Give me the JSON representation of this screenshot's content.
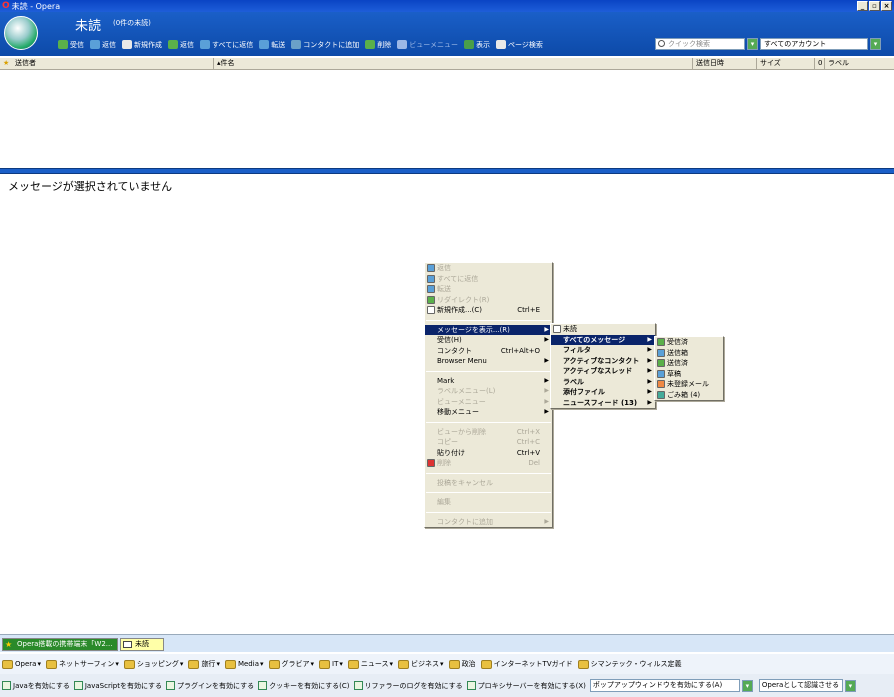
{
  "window": {
    "title": "未読 - Opera",
    "buttons": [
      "_",
      "▫",
      "×"
    ]
  },
  "header": {
    "folder_title": "未読",
    "folder_count": "(0件の未読)"
  },
  "toolbar": {
    "items": [
      {
        "label": "受信",
        "icon": "receive-icon",
        "color": "#5ab04a"
      },
      {
        "label": "返信",
        "icon": "reply-icon",
        "color": "#5aa0d8"
      },
      {
        "label": "新規作成",
        "icon": "compose-icon",
        "color": "#e8e8e8"
      },
      {
        "label": "返信",
        "icon": "reply2-icon",
        "color": "#5ab04a"
      },
      {
        "label": "すべてに返信",
        "icon": "reply-all-icon",
        "color": "#5aa0d8"
      },
      {
        "label": "転送",
        "icon": "forward-icon",
        "color": "#5aa0d8"
      },
      {
        "label": "コンタクトに追加",
        "icon": "contact-icon",
        "color": "#6aa0c8"
      },
      {
        "label": "削除",
        "icon": "delete-icon",
        "color": "#5ab04a"
      },
      {
        "label": "ビューメニュー",
        "icon": "view-menu-icon",
        "color": "#9bb7e6"
      },
      {
        "label": "表示",
        "icon": "show-icon",
        "color": "#4a9e4a"
      },
      {
        "label": "ページ検索",
        "icon": "page-search-icon",
        "color": "#e8e8e8"
      }
    ],
    "quick_search_placeholder": "クイック検索",
    "account": "すべてのアカウント"
  },
  "columns": [
    "送信者",
    "件名",
    "送信日時",
    "サイズ",
    "ラベル"
  ],
  "preview": {
    "empty_text": "メッセージが選択されていません"
  },
  "context_menu": {
    "items": [
      {
        "label": "返信",
        "disabled": true,
        "icon": "reply-icon"
      },
      {
        "label": "すべてに返信",
        "disabled": true,
        "icon": "reply-all-icon"
      },
      {
        "label": "転送",
        "disabled": true,
        "icon": "forward-icon"
      },
      {
        "label": "リダイレクト(R)",
        "disabled": true,
        "icon": "redirect-icon"
      },
      {
        "label": "新規作成...(C)",
        "shortcut": "Ctrl+E",
        "icon": "compose-icon"
      },
      {
        "sep": true
      },
      {
        "label": "メッセージを表示...(R)",
        "arrow": true,
        "highlight": true
      },
      {
        "label": "受信(H)",
        "arrow": true
      },
      {
        "label": "コンタクト",
        "shortcut": "Ctrl+Alt+O"
      },
      {
        "label": "Browser Menu",
        "arrow": true
      },
      {
        "sep": true
      },
      {
        "label": "Mark",
        "arrow": true
      },
      {
        "label": "ラベルメニュー(L)",
        "arrow": true,
        "disabled": true
      },
      {
        "label": "ビューメニュー",
        "arrow": true,
        "disabled": true
      },
      {
        "label": "移動メニュー",
        "arrow": true
      },
      {
        "sep": true
      },
      {
        "label": "ビューから削除",
        "shortcut": "Ctrl+X",
        "disabled": true
      },
      {
        "label": "コピー",
        "shortcut": "Ctrl+C",
        "disabled": true
      },
      {
        "label": "貼り付け",
        "shortcut": "Ctrl+V"
      },
      {
        "label": "削除",
        "shortcut": "Del",
        "disabled": true,
        "icon": "delete-icon"
      },
      {
        "sep": true
      },
      {
        "label": "投稿をキャンセル",
        "disabled": true
      },
      {
        "sep": true
      },
      {
        "label": "編集",
        "disabled": true
      },
      {
        "sep": true
      },
      {
        "label": "コンタクトに追加",
        "arrow": true,
        "disabled": true
      }
    ]
  },
  "submenu1": {
    "items": [
      {
        "label": "未読",
        "icon": "unread-icon"
      },
      {
        "label": "すべてのメッセージ",
        "arrow": true,
        "highlight": true,
        "bold": true
      },
      {
        "label": "フィルタ",
        "arrow": true,
        "bold": true
      },
      {
        "label": "アクティブなコンタクト",
        "arrow": true,
        "bold": true
      },
      {
        "label": "アクティブなスレッド",
        "arrow": true,
        "bold": true
      },
      {
        "label": "ラベル",
        "arrow": true,
        "bold": true
      },
      {
        "label": "添付ファイル",
        "arrow": true,
        "bold": true
      },
      {
        "label": "ニュースフィード (13)",
        "arrow": true,
        "bold": true
      }
    ]
  },
  "submenu2": {
    "items": [
      {
        "label": "受信済",
        "icon": "received-icon"
      },
      {
        "label": "送信箱",
        "icon": "outbox-icon"
      },
      {
        "label": "送信済",
        "icon": "sent-icon"
      },
      {
        "label": "草稿",
        "icon": "drafts-icon"
      },
      {
        "label": "未登録メール",
        "icon": "spam-icon"
      },
      {
        "label": "ごみ箱 (4)",
        "icon": "trash-icon"
      }
    ]
  },
  "tasks": [
    {
      "label": "Opera搭載の携帯端末「W2...",
      "active": false
    },
    {
      "label": "未読",
      "active": true
    }
  ],
  "bookmarks": [
    "Opera",
    "ネットサーフィン",
    "ショッピング",
    "旅行",
    "Media",
    "グラビア",
    "IT",
    "ニュース",
    "ビジネス",
    "政治",
    "インターネットTVガイド",
    "シマンテック・ウィルス定義"
  ],
  "quick_prefs": {
    "items": [
      "Javaを有効にする",
      "JavaScriptを有効にする",
      "プラグインを有効にする",
      "クッキーを有効にする(C)",
      "リファラーのログを有効にする",
      "プロキシサーバーを有効にする(X)"
    ],
    "popup_select": "ポップアップウィンドウを有効にする(A)",
    "identify_select": "Operaとして認識させる"
  }
}
